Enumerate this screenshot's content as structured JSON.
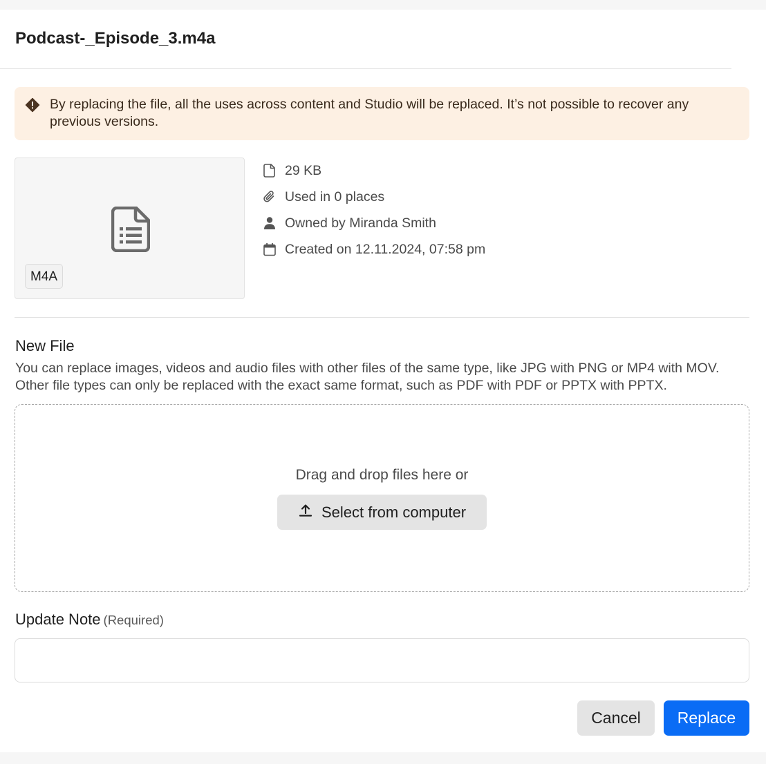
{
  "dialog": {
    "title": "Podcast-_Episode_3.m4a"
  },
  "warning": {
    "icon": "warning-diamond-icon",
    "text": "By replacing the file, all the uses across content and Studio will be replaced. It’s not possible to recover any previous versions.",
    "background_color": "#fdf0e3"
  },
  "preview": {
    "icon": "document-icon",
    "type_badge": "M4A"
  },
  "meta": {
    "size": "29 KB",
    "usage": "Used in 0 places",
    "owner": "Owned by Miranda Smith",
    "created": "Created on 12.11.2024, 07:58 pm"
  },
  "new_file": {
    "title": "New File",
    "description": "You can replace images, videos and audio files with other files of the same type, like JPG with PNG or MP4 with MOV. Other file types can only be replaced with the exact same format, such as PDF with PDF or PPTX with PPTX.",
    "drop_text": "Drag and drop files here or",
    "select_label": "Select from computer"
  },
  "update_note": {
    "label": "Update Note",
    "required": "(Required)",
    "value": "",
    "placeholder": ""
  },
  "actions": {
    "cancel_label": "Cancel",
    "replace_label": "Replace",
    "primary_color": "#0a6cf5"
  }
}
